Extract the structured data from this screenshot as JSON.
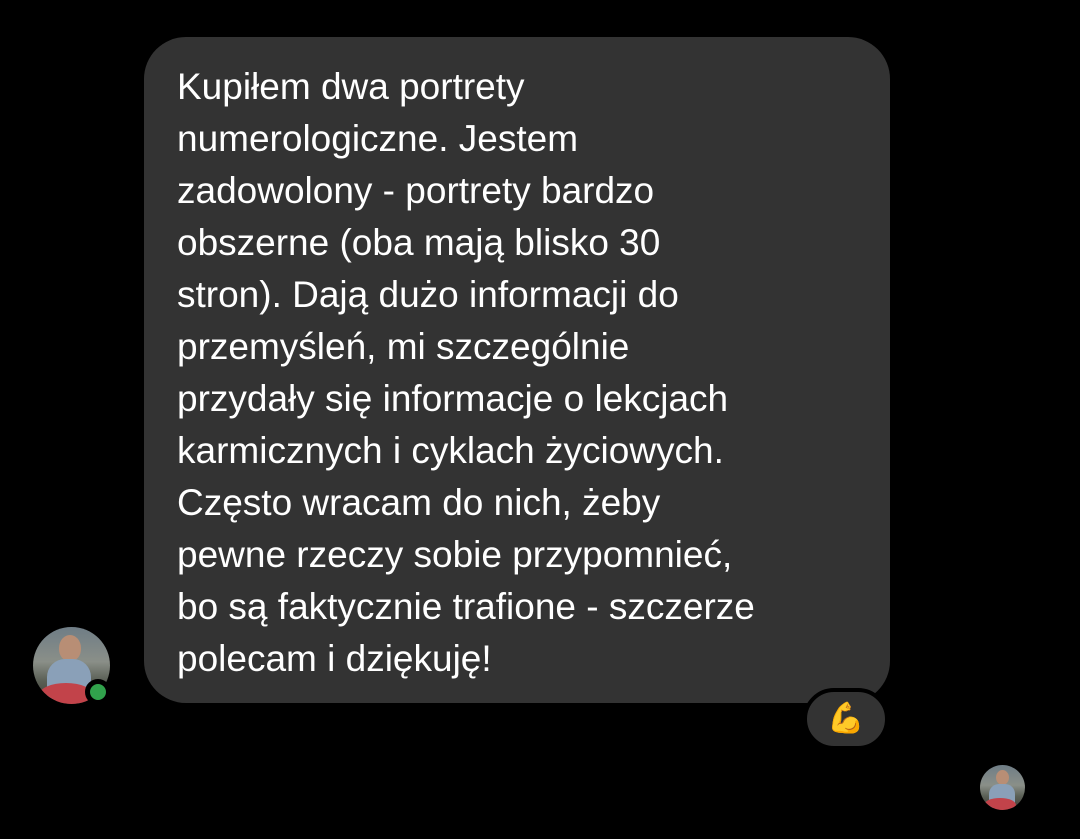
{
  "message": {
    "text": "Kupiłem dwa portrety\nnumerologiczne. Jestem\nzadowolony - portrety bardzo\nobszerne (oba mają blisko 30\nstron). Dają dużo informacji do\nprzemyśleń, mi szczególnie\nprzydały się informacje o lekcjach\nkarmicznych i cyklach życiowych.\nCzęsto wracam do nich, żeby\npewne rzeczy sobie przypomnieć,\nbo są faktycznie trafione - szczerze\npolecam i dziękuję!",
    "bubble_color": "#333333",
    "text_color": "#ffffff"
  },
  "reaction": {
    "emoji": "💪",
    "icon": "flexed-biceps-icon"
  },
  "sender": {
    "avatar_icon": "user-avatar",
    "online": true,
    "online_color": "#31a24c"
  },
  "seen_indicator": {
    "avatar_icon": "seen-avatar"
  },
  "theme": {
    "background": "#000000"
  }
}
